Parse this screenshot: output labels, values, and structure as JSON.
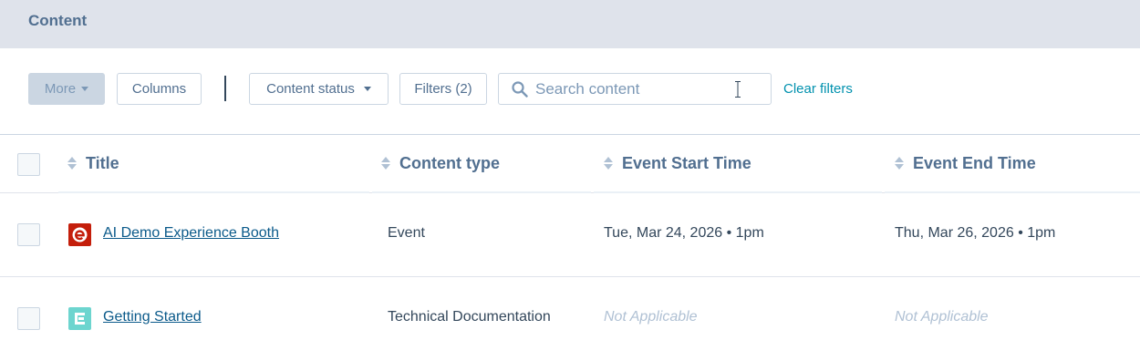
{
  "header": {
    "title": "Content"
  },
  "toolbar": {
    "more_label": "More",
    "columns_label": "Columns",
    "content_status_label": "Content status",
    "filters_label": "Filters (2)",
    "search_placeholder": "Search content",
    "search_value": "",
    "clear_filters_label": "Clear filters"
  },
  "table": {
    "columns": [
      "Title",
      "Content type",
      "Event Start Time",
      "Event End Time"
    ],
    "rows": [
      {
        "icon": "event-icon",
        "icon_color": "#c41e0b",
        "title": "AI Demo Experience Booth",
        "content_type": "Event",
        "start": "Tue, Mar 24, 2026 • 1pm",
        "end": "Thu, Mar 26, 2026 • 1pm"
      },
      {
        "icon": "documentation-icon",
        "icon_color": "#6dd5cf",
        "title": "Getting Started",
        "content_type": "Technical Documentation",
        "start": "Not Applicable",
        "end": "Not Applicable"
      }
    ]
  },
  "colors": {
    "header_bg": "#dfe3eb",
    "link": "#0091ae",
    "text": "#33475b"
  }
}
